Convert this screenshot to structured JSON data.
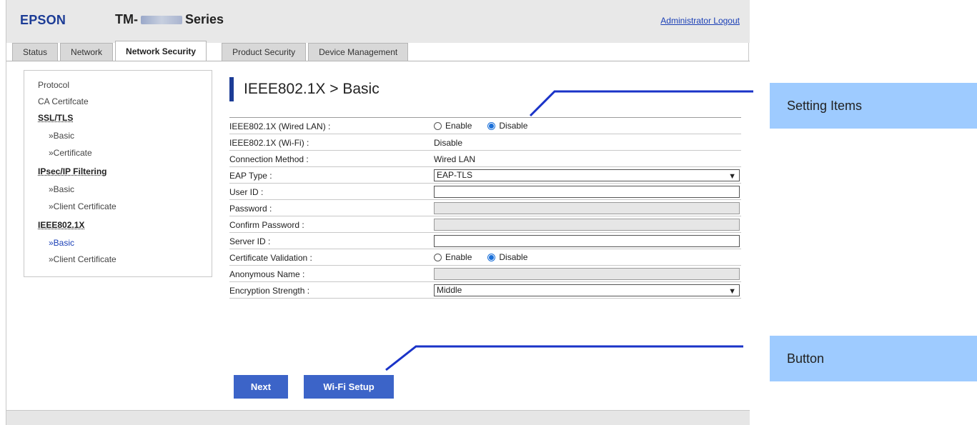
{
  "header": {
    "brand": "EPSON",
    "model_prefix": "TM-",
    "model_suffix": "Series",
    "logout_link": "Administrator Logout"
  },
  "tabs": [
    {
      "label": "Status"
    },
    {
      "label": "Network"
    },
    {
      "label": "Network Security",
      "active": true
    },
    {
      "label": "Product Security"
    },
    {
      "label": "Device Management"
    }
  ],
  "sidebar": {
    "protocol": "Protocol",
    "ca_certificate": "CA Certifcate",
    "ssl_tls": "SSL/TLS",
    "ssl_basic": "»Basic",
    "ssl_certificate": "»Certificate",
    "ipsec": "IPsec/IP Filtering",
    "ipsec_basic": "»Basic",
    "ipsec_client_cert": "»Client Certificate",
    "ieee": "IEEE802.1X",
    "ieee_basic": "»Basic",
    "ieee_client_cert": "»Client Certificate"
  },
  "page_title": "IEEE802.1X > Basic",
  "form": {
    "wired_lan": {
      "label": "IEEE802.1X (Wired LAN) :",
      "enable": "Enable",
      "disable": "Disable",
      "selected": "Disable"
    },
    "wifi": {
      "label": "IEEE802.1X (Wi-Fi) :",
      "value": "Disable"
    },
    "connection": {
      "label": "Connection Method :",
      "value": "Wired LAN"
    },
    "eap_type": {
      "label": "EAP Type :",
      "value": "EAP-TLS"
    },
    "user_id": {
      "label": "User ID :",
      "value": ""
    },
    "password": {
      "label": "Password :",
      "value": ""
    },
    "confirm_password": {
      "label": "Confirm Password :",
      "value": ""
    },
    "server_id": {
      "label": "Server ID :",
      "value": ""
    },
    "cert_validation": {
      "label": "Certificate Validation :",
      "enable": "Enable",
      "disable": "Disable",
      "selected": "Disable"
    },
    "anonymous": {
      "label": "Anonymous Name :",
      "value": ""
    },
    "encryption": {
      "label": "Encryption Strength :",
      "value": "Middle"
    }
  },
  "buttons": {
    "next": "Next",
    "wifi_setup": "Wi-Fi Setup"
  },
  "callouts": {
    "setting_items": "Setting Items",
    "button": "Button"
  },
  "colors": {
    "brand_blue": "#1c3c96",
    "button_blue": "#3c64c8",
    "callout_blue": "#9ecbff",
    "link_blue": "#1a3fb6"
  }
}
